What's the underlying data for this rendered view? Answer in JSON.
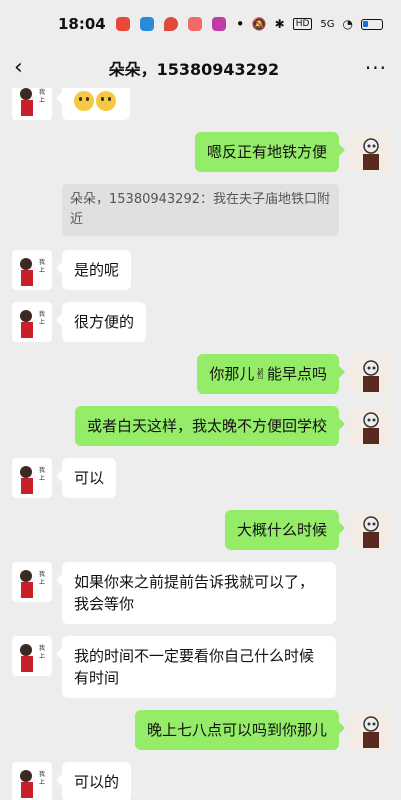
{
  "status_bar": {
    "time": "18:04",
    "network": "5G",
    "hd": "HD",
    "accent_battery": "#1a6fe0"
  },
  "header": {
    "title": "朵朵，15380943292",
    "back_icon": "chevron-left-icon",
    "more_icon": "more-dots-icon"
  },
  "quote": {
    "text": "朵朵，15380943292：我在夫子庙地铁口附近"
  },
  "messages": [
    {
      "side": "left",
      "text": ""
    },
    {
      "side": "right",
      "text": "嗯反正有地铁方便"
    },
    {
      "side": "left",
      "text": "是的呢"
    },
    {
      "side": "left",
      "text": "很方便的"
    },
    {
      "side": "right",
      "text": "你那儿✌能早点吗"
    },
    {
      "side": "right",
      "text": "或者白天这样，我太晚不方便回学校"
    },
    {
      "side": "left",
      "text": "可以"
    },
    {
      "side": "right",
      "text": "大概什么时候"
    },
    {
      "side": "left",
      "text": "如果你来之前提前告诉我就可以了，我会等你"
    },
    {
      "side": "left",
      "text": "我的时间不一定要看你自己什么时候有时间"
    },
    {
      "side": "right",
      "text": "晚上七八点可以吗到你那儿"
    },
    {
      "side": "left",
      "text": "可以的"
    }
  ],
  "colors": {
    "background": "#ededed",
    "sent_bubble": "#95ec69",
    "received_bubble": "#ffffff"
  }
}
